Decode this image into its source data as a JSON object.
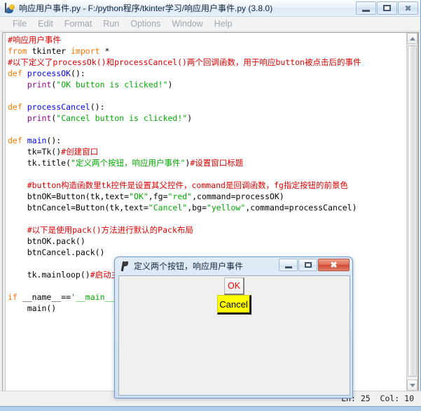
{
  "main_window": {
    "title": "响应用户事件.py - F:/python程序/tkinter学习/响应用户事件.py (3.8.0)",
    "icon": "idle-python-icon",
    "controls": {
      "minimize": "minimize-icon",
      "maximize": "maximize-icon",
      "close": "close-icon"
    },
    "menubar": [
      {
        "label": "File"
      },
      {
        "label": "Edit"
      },
      {
        "label": "Format"
      },
      {
        "label": "Run"
      },
      {
        "label": "Options"
      },
      {
        "label": "Window"
      },
      {
        "label": "Help"
      }
    ],
    "statusbar": {
      "position": "Ln: 25  Col: 10"
    },
    "scrollbar": {
      "up_arrow": "scroll-up-icon",
      "down_arrow": "scroll-down-icon"
    }
  },
  "editor": {
    "language": "python",
    "colors": {
      "comment": "#dd0000",
      "keyword": "#ff7700",
      "definition": "#0000ff",
      "builtin": "#900090",
      "string": "#00aa00",
      "plain": "#000000",
      "background": "#ffffff"
    },
    "lines": [
      [
        {
          "t": "com",
          "s": "#响应用户事件"
        }
      ],
      [
        {
          "t": "kw",
          "s": "from"
        },
        {
          "t": "plain",
          "s": " tkinter "
        },
        {
          "t": "kw",
          "s": "import"
        },
        {
          "t": "plain",
          "s": " *"
        }
      ],
      [
        {
          "t": "com",
          "s": "#以下定义了processOk()和processCancel()两个回调函数，用于响应button被点击后的事件"
        }
      ],
      [
        {
          "t": "kw",
          "s": "def"
        },
        {
          "t": "plain",
          "s": " "
        },
        {
          "t": "def",
          "s": "processOK"
        },
        {
          "t": "plain",
          "s": "():"
        }
      ],
      [
        {
          "t": "plain",
          "s": "    "
        },
        {
          "t": "bi",
          "s": "print"
        },
        {
          "t": "plain",
          "s": "("
        },
        {
          "t": "str",
          "s": "\"OK button is clicked!\""
        },
        {
          "t": "plain",
          "s": ")"
        }
      ],
      [
        {
          "t": "plain",
          "s": ""
        }
      ],
      [
        {
          "t": "kw",
          "s": "def"
        },
        {
          "t": "plain",
          "s": " "
        },
        {
          "t": "def",
          "s": "processCancel"
        },
        {
          "t": "plain",
          "s": "():"
        }
      ],
      [
        {
          "t": "plain",
          "s": "    "
        },
        {
          "t": "bi",
          "s": "print"
        },
        {
          "t": "plain",
          "s": "("
        },
        {
          "t": "str",
          "s": "\"Cancel button is clicked!\""
        },
        {
          "t": "plain",
          "s": ")"
        }
      ],
      [
        {
          "t": "plain",
          "s": ""
        }
      ],
      [
        {
          "t": "kw",
          "s": "def"
        },
        {
          "t": "plain",
          "s": " "
        },
        {
          "t": "def",
          "s": "main"
        },
        {
          "t": "plain",
          "s": "():"
        }
      ],
      [
        {
          "t": "plain",
          "s": "    tk=Tk()"
        },
        {
          "t": "com",
          "s": "#创建窗口"
        }
      ],
      [
        {
          "t": "plain",
          "s": "    tk.title("
        },
        {
          "t": "str",
          "s": "\"定义两个按钮，响应用户事件\""
        },
        {
          "t": "plain",
          "s": ")"
        },
        {
          "t": "com",
          "s": "#设置窗口标题"
        }
      ],
      [
        {
          "t": "plain",
          "s": ""
        }
      ],
      [
        {
          "t": "plain",
          "s": "    "
        },
        {
          "t": "com",
          "s": "#button构造函数里tk控件是设置其父控件，command是回调函数，fg指定按钮的前景色"
        }
      ],
      [
        {
          "t": "plain",
          "s": "    btnOK=Button(tk,text="
        },
        {
          "t": "str",
          "s": "\"OK\""
        },
        {
          "t": "plain",
          "s": ",fg="
        },
        {
          "t": "str",
          "s": "\"red\""
        },
        {
          "t": "plain",
          "s": ",command=processOK)"
        }
      ],
      [
        {
          "t": "plain",
          "s": "    btnCancel=Button(tk,text="
        },
        {
          "t": "str",
          "s": "\"Cancel\""
        },
        {
          "t": "plain",
          "s": ",bg="
        },
        {
          "t": "str",
          "s": "\"yellow\""
        },
        {
          "t": "plain",
          "s": ",command=processCancel)"
        }
      ],
      [
        {
          "t": "plain",
          "s": ""
        }
      ],
      [
        {
          "t": "plain",
          "s": "    "
        },
        {
          "t": "com",
          "s": "#以下是使用pack()方法进行默认的Pack布局"
        }
      ],
      [
        {
          "t": "plain",
          "s": "    btnOK.pack()"
        }
      ],
      [
        {
          "t": "plain",
          "s": "    btnCancel.pack()"
        }
      ],
      [
        {
          "t": "plain",
          "s": ""
        }
      ],
      [
        {
          "t": "plain",
          "s": "    tk.mainloop()"
        },
        {
          "t": "com",
          "s": "#启动主窗口的消息循环"
        }
      ],
      [
        {
          "t": "plain",
          "s": ""
        }
      ],
      [
        {
          "t": "kw",
          "s": "if"
        },
        {
          "t": "plain",
          "s": " __name__=="
        },
        {
          "t": "str",
          "s": "'__main__'"
        },
        {
          "t": "plain",
          "s": ":"
        }
      ],
      [
        {
          "t": "plain",
          "s": "    main()"
        }
      ]
    ]
  },
  "tk_dialog": {
    "title": "定义两个按钮，响应用户事件",
    "icon": "feather-icon",
    "controls": {
      "minimize": "minimize-icon",
      "maximize": "maximize-icon",
      "close": "close-icon"
    },
    "buttons": [
      {
        "name": "ok-button",
        "label": "OK",
        "fg": "#ff0000",
        "bg": "#ececec"
      },
      {
        "name": "cancel-button",
        "label": "Cancel",
        "fg": "#000000",
        "bg": "#ffff00"
      }
    ]
  }
}
